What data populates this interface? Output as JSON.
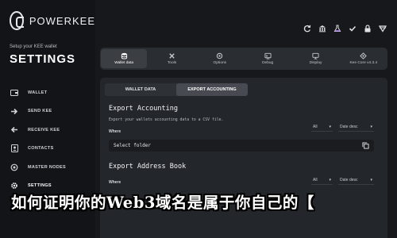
{
  "brand": {
    "name": "POWERKEE"
  },
  "sidebar": {
    "subtitle": "Setup your KEE wallet",
    "title": "SETTINGS",
    "items": [
      {
        "label": "WALLET",
        "icon": "wallet-icon"
      },
      {
        "label": "SEND KEE",
        "icon": "send-icon"
      },
      {
        "label": "RECEIVE KEE",
        "icon": "receive-icon"
      },
      {
        "label": "CONTACTS",
        "icon": "contacts-icon"
      },
      {
        "label": "MASTER NODES",
        "icon": "master-nodes-icon"
      },
      {
        "label": "SETTINGS",
        "icon": "gear-icon"
      }
    ]
  },
  "status_icons": [
    "sync-icon",
    "bank-icon",
    "flask-icon",
    "check-icon",
    "lock-icon",
    "staking-icon"
  ],
  "tabs": [
    {
      "label": "Wallet data",
      "icon": "database-icon",
      "active": true
    },
    {
      "label": "Tools",
      "icon": "tools-icon",
      "active": false
    },
    {
      "label": "Options",
      "icon": "options-icon",
      "active": false
    },
    {
      "label": "Debug",
      "icon": "debug-icon",
      "active": false
    },
    {
      "label": "Display",
      "icon": "display-icon",
      "active": false
    },
    {
      "label": "Kee Core v4.3.4",
      "icon": "core-icon",
      "active": false
    }
  ],
  "subtabs": [
    {
      "label": "WALLET DATA",
      "active": false
    },
    {
      "label": "EXPORT ACCOUNTING",
      "active": true
    }
  ],
  "export_accounting": {
    "title": "Export Accounting",
    "description": "Export your wallets accounting data to a CSV file.",
    "where_label": "Where",
    "filter_all": "All",
    "filter_sort": "Date desc",
    "folder_placeholder": "Select folder"
  },
  "export_address_book": {
    "title": "Export Address Book",
    "where_label": "Where",
    "filter_all": "All",
    "filter_sort": "Date desc"
  },
  "overlay_caption": "如何证明你的Web3域名是属于你自己的【",
  "colors": {
    "background": "#16181c",
    "panel": "#23262a",
    "accent": "#a070e0"
  }
}
